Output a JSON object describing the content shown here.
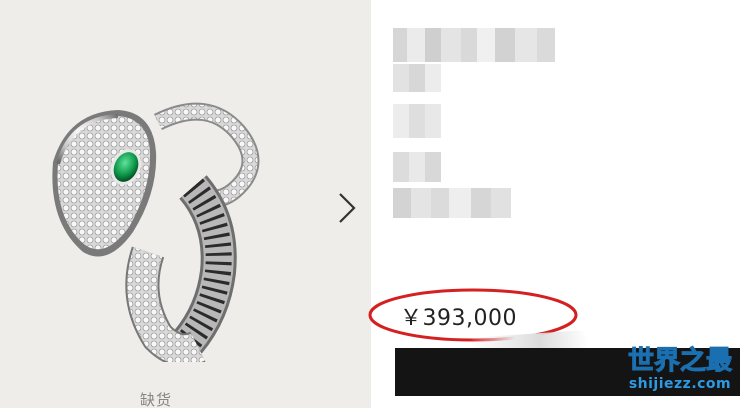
{
  "product": {
    "image_alt": "serpent ring with emerald eyes",
    "stock_status": "缺货",
    "price": "￥393,000"
  },
  "watermark": {
    "main": "世界之最",
    "sub": "shijiezz.com"
  },
  "icons": {
    "next": "chevron-right-icon"
  },
  "colors": {
    "image_bg": "#efedea",
    "button": "#141414",
    "circle": "#d42020",
    "watermark": "#2d9be3"
  }
}
